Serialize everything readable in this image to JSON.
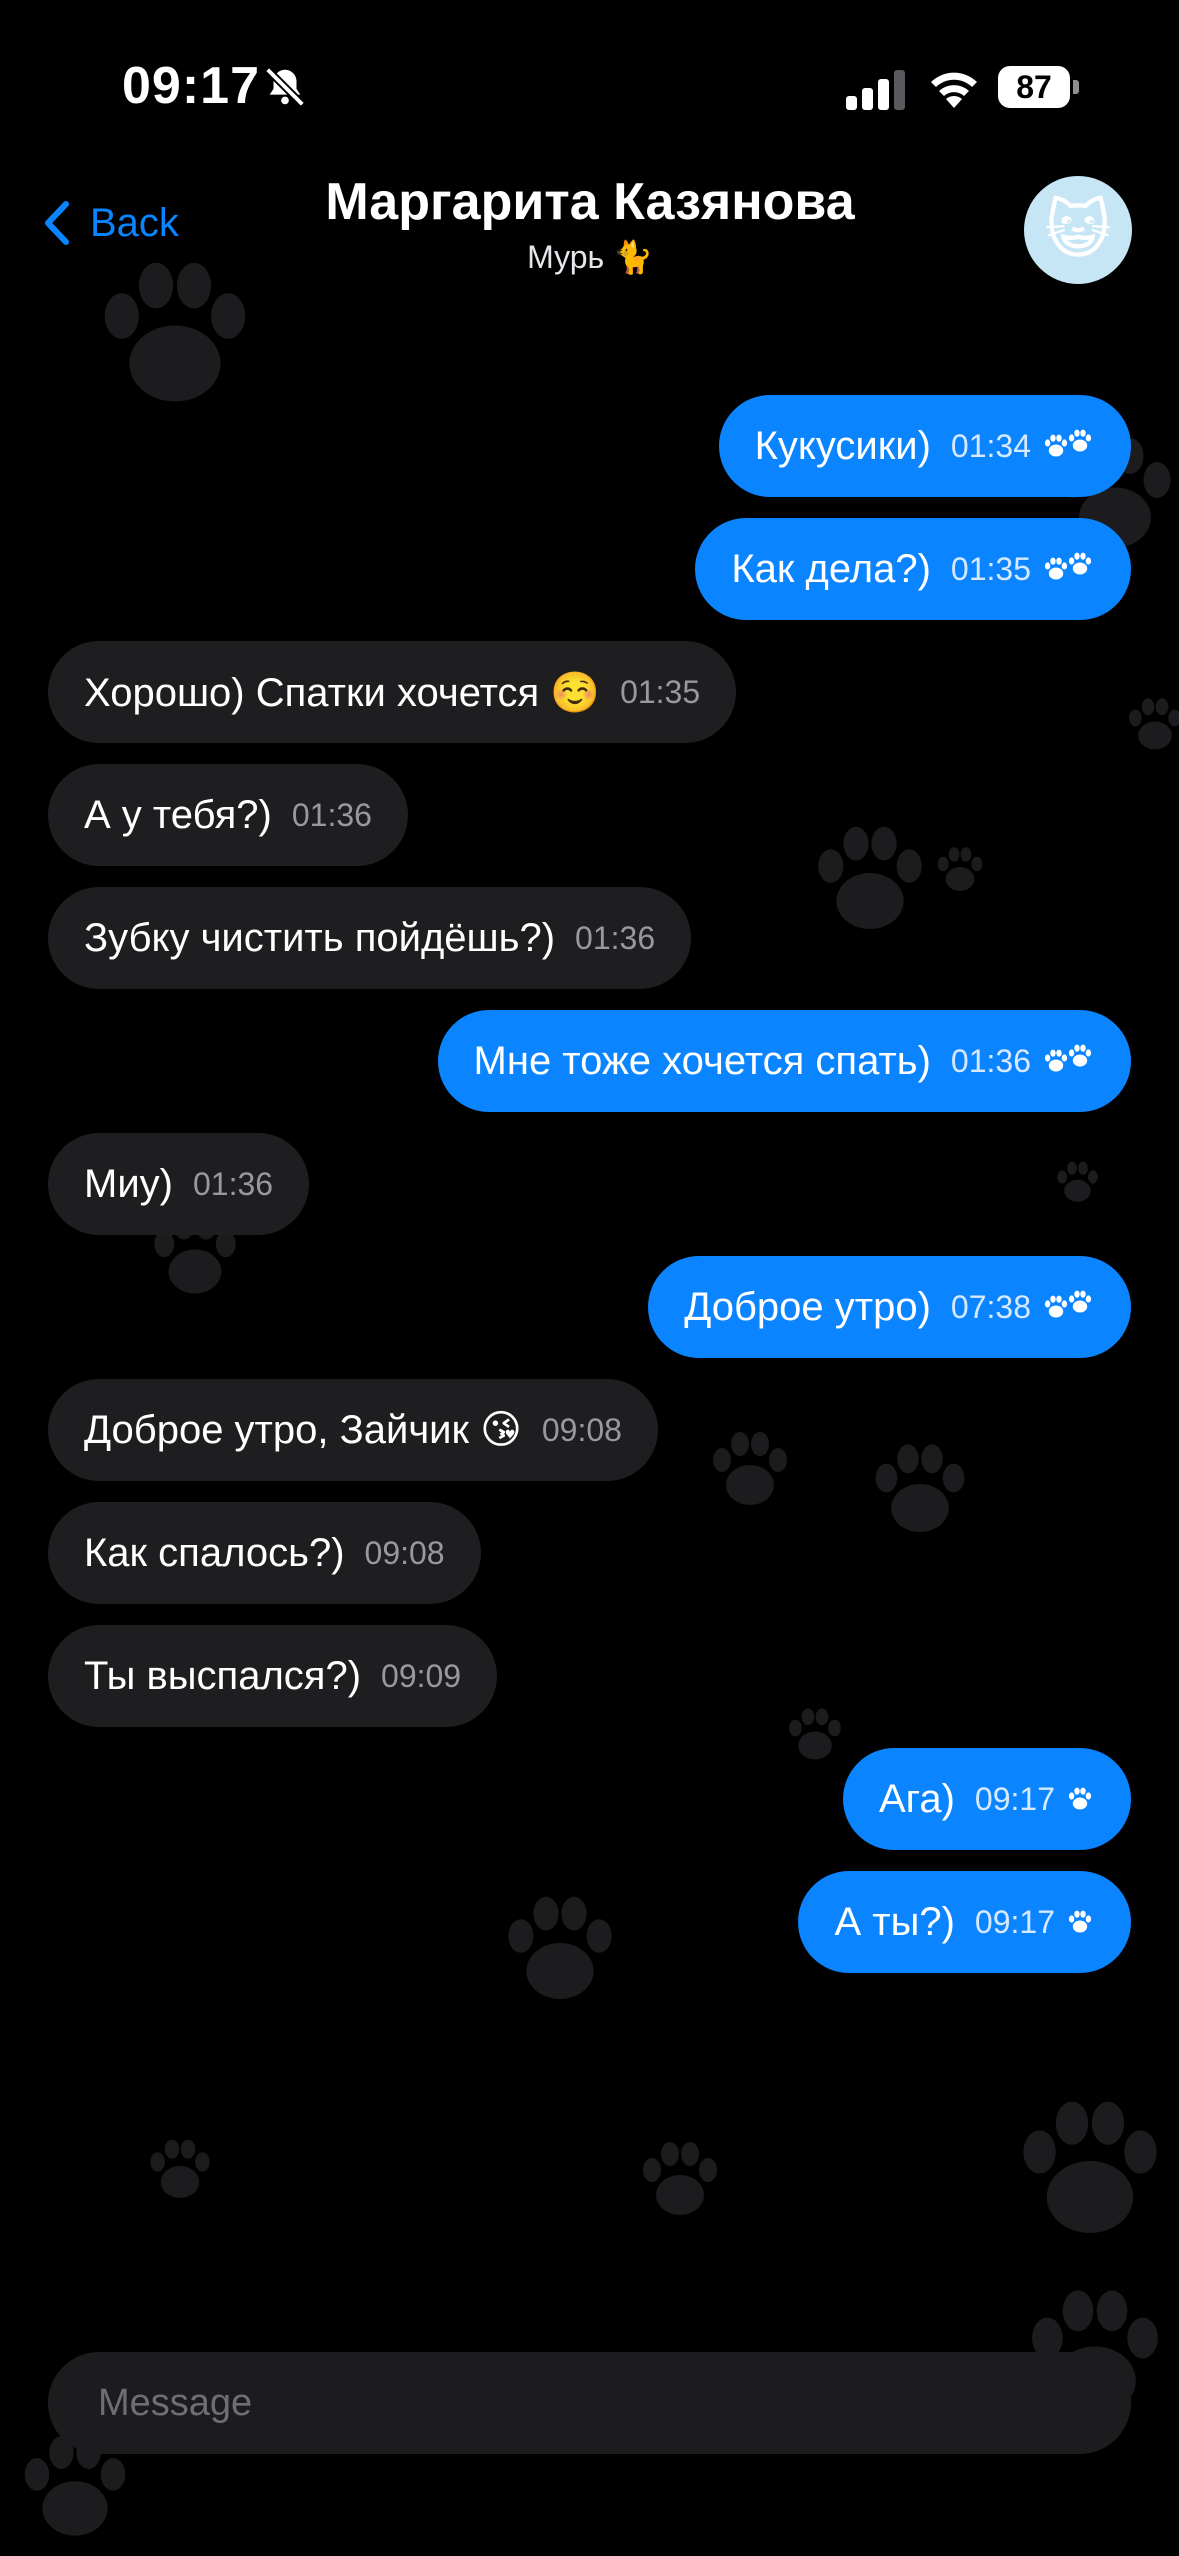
{
  "status_bar": {
    "time": "09:17",
    "battery": "87"
  },
  "header": {
    "back_label": "Back",
    "title": "Маргарита Казянова",
    "subtitle": "Мурь 🐈",
    "avatar_emoji": "😺"
  },
  "messages": [
    {
      "dir": "out",
      "text": "Кукусики)",
      "time": "01:34",
      "read": true
    },
    {
      "dir": "out",
      "text": "Как дела?)",
      "time": "01:35",
      "read": true
    },
    {
      "dir": "in",
      "text": "Хорошо) Спатки хочется ☺️",
      "time": "01:35"
    },
    {
      "dir": "in",
      "text": "А у тебя?)",
      "time": "01:36"
    },
    {
      "dir": "in",
      "text": "Зубку чистить пойдёшь?)",
      "time": "01:36"
    },
    {
      "dir": "out",
      "text": "Мне тоже хочется спать)",
      "time": "01:36",
      "read": true
    },
    {
      "dir": "in",
      "text": "Миу)",
      "time": "01:36"
    },
    {
      "dir": "out",
      "text": "Доброе утро)",
      "time": "07:38",
      "read": true
    },
    {
      "dir": "in",
      "text": "Доброе утро, Зайчик 😘",
      "time": "09:08"
    },
    {
      "dir": "in",
      "text": "Как спалось?)",
      "time": "09:08"
    },
    {
      "dir": "in",
      "text": "Ты выспался?)",
      "time": "09:09"
    },
    {
      "dir": "out",
      "text": "Ага)",
      "time": "09:17",
      "read": false
    },
    {
      "dir": "out",
      "text": "А ты?)",
      "time": "09:17",
      "read": false
    }
  ],
  "composer": {
    "placeholder": "Message"
  },
  "icons": {
    "back": "chevron-left-icon",
    "bell": "bell-slash-icon",
    "signal": "cellular-signal-icon",
    "wifi": "wifi-icon",
    "ticks": "paw-icon"
  },
  "colors": {
    "accent": "#0a84ff",
    "incoming_bubble": "#1e1e20",
    "background": "#000000"
  }
}
